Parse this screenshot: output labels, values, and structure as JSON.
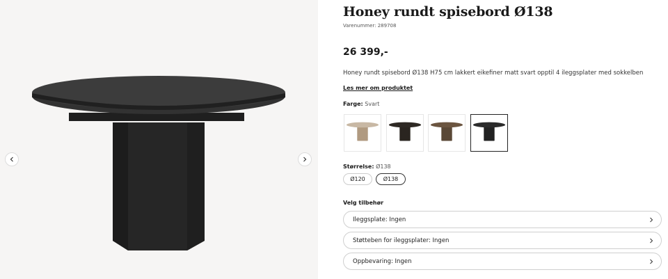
{
  "gallery": {
    "prev_icon": "chevron-left-icon",
    "next_icon": "chevron-right-icon",
    "image_alt": "Honey rundt spisebord Ø138, svart"
  },
  "product": {
    "title": "Honey rundt spisebord Ø138",
    "sku": "Varenummer: 289708",
    "price": "26 399,-",
    "description": "Honey rundt spisebord Ø138 H75 cm lakkert eikefiner matt svart opptil 4 ileggsplater med sokkelben",
    "read_more": "Les mer om produktet"
  },
  "color": {
    "label": "Farge:",
    "value": "Svart",
    "options": [
      {
        "name": "Natur eik",
        "top": "#c8b8a4",
        "base": "#b09a80"
      },
      {
        "name": "Mørk brun",
        "top": "#2e2924",
        "base": "#2a2520"
      },
      {
        "name": "Brun",
        "top": "#6b5540",
        "base": "#5a4836"
      },
      {
        "name": "Svart",
        "top": "#2b2b2b",
        "base": "#222222"
      }
    ],
    "selected_index": 3
  },
  "size": {
    "label": "Størrelse:",
    "value": "Ø138",
    "options": [
      "Ø120",
      "Ø138"
    ],
    "selected_index": 1
  },
  "accessories": {
    "title": "Velg tilbehør",
    "items": [
      {
        "label": "Ileggsplate: Ingen"
      },
      {
        "label": "Støtteben for ileggsplater: Ingen"
      },
      {
        "label": "Oppbevaring: Ingen"
      }
    ]
  },
  "colors": {
    "gallery_bg": "#f6f5f4",
    "table": "#2a2a2a"
  }
}
